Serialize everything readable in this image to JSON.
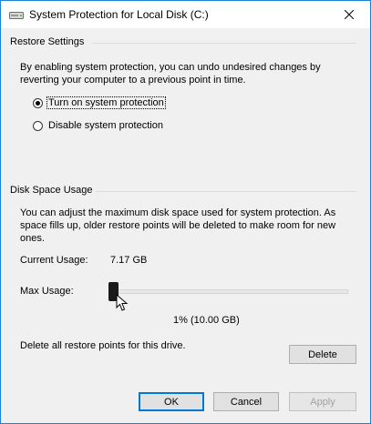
{
  "window": {
    "title": "System Protection for Local Disk (C:)",
    "accent_color": "#1883d7"
  },
  "restore_settings": {
    "group_label": "Restore Settings",
    "description": "By enabling system protection, you can undo undesired changes by reverting your computer to a previous point in time.",
    "options": [
      {
        "label": "Turn on system protection",
        "selected": true,
        "focused": true
      },
      {
        "label": "Disable system protection",
        "selected": false,
        "focused": false
      }
    ]
  },
  "disk_space": {
    "group_label": "Disk Space Usage",
    "description": "You can adjust the maximum disk space used for system protection. As space fills up, older restore points will be deleted to make room for new ones.",
    "current_usage_label": "Current Usage:",
    "current_usage_value": "7.17 GB",
    "max_usage_label": "Max Usage:",
    "max_usage_value": "1% (10.00 GB)",
    "slider_fraction": 0.0,
    "delete_description": "Delete all restore points for this drive.",
    "delete_button": "Delete"
  },
  "buttons": {
    "ok": "OK",
    "cancel": "Cancel",
    "apply": "Apply"
  }
}
